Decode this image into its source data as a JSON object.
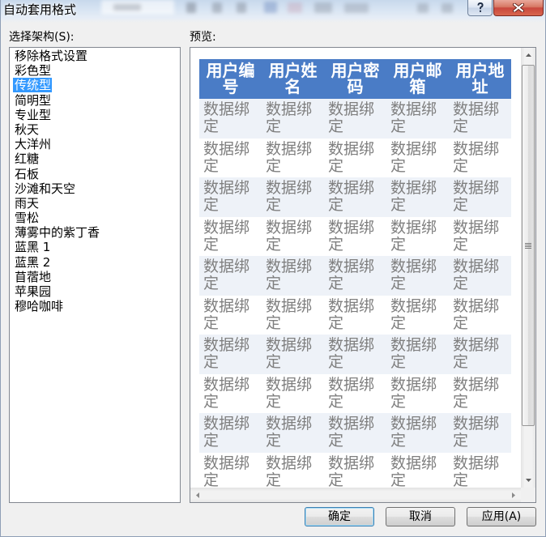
{
  "window": {
    "title": "自动套用格式",
    "icons": {
      "help": "help-icon",
      "close": "close-icon"
    }
  },
  "schemes": {
    "label": "选择架构(S):",
    "selected_index": 2,
    "items": [
      "移除格式设置",
      "彩色型",
      "传统型",
      "简明型",
      "专业型",
      "秋天",
      "大洋州",
      "红糖",
      "石板",
      "沙滩和天空",
      "雨天",
      "雪松",
      "薄雾中的紫丁香",
      "蓝黑 1",
      "蓝黑 2",
      "苜蓿地",
      "苹果园",
      "穆哈咖啡"
    ]
  },
  "preview": {
    "label": "预览:",
    "headers": [
      "用户编号",
      "用户姓名",
      "用户密码",
      "用户邮箱",
      "用户地址"
    ],
    "rows": [
      [
        "数据绑定",
        "数据绑定",
        "数据绑定",
        "数据绑定",
        "数据绑定"
      ],
      [
        "数据绑定",
        "数据绑定",
        "数据绑定",
        "数据绑定",
        "数据绑定"
      ],
      [
        "数据绑定",
        "数据绑定",
        "数据绑定",
        "数据绑定",
        "数据绑定"
      ],
      [
        "数据绑定",
        "数据绑定",
        "数据绑定",
        "数据绑定",
        "数据绑定"
      ],
      [
        "数据绑定",
        "数据绑定",
        "数据绑定",
        "数据绑定",
        "数据绑定"
      ],
      [
        "数据绑定",
        "数据绑定",
        "数据绑定",
        "数据绑定",
        "数据绑定"
      ],
      [
        "数据绑定",
        "数据绑定",
        "数据绑定",
        "数据绑定",
        "数据绑定"
      ],
      [
        "数据绑定",
        "数据绑定",
        "数据绑定",
        "数据绑定",
        "数据绑定"
      ],
      [
        "数据绑定",
        "数据绑定",
        "数据绑定",
        "数据绑定",
        "数据绑定"
      ],
      [
        "数据绑定",
        "数据绑定",
        "数据绑定",
        "数据绑定",
        "数据绑定"
      ]
    ],
    "colors": {
      "header_bg": "#4A7CC6",
      "header_text": "#FFFFFF",
      "cell_text": "#7F7F7F",
      "alt_row_bg": "#EEF2F8",
      "row_bg": "#FFFFFF"
    }
  },
  "buttons": {
    "ok": "确定",
    "cancel": "取消",
    "apply": "应用(A)"
  },
  "colors": {
    "selection": "#3399FF",
    "close_button": "#C9483E"
  }
}
